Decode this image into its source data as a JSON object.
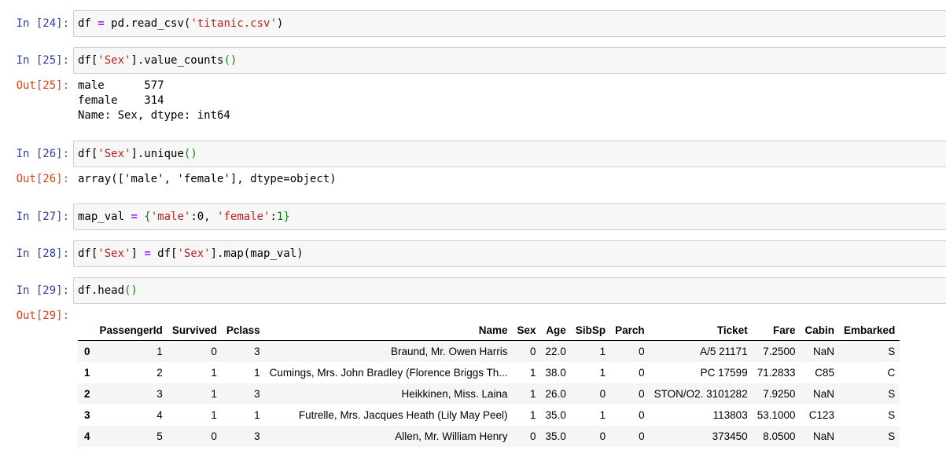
{
  "cells": [
    {
      "prompt": "In [24]:",
      "code": [
        {
          "t": "df ",
          "c": ""
        },
        {
          "t": "=",
          "c": "op"
        },
        {
          "t": " pd.read_csv(",
          "c": ""
        },
        {
          "t": "'titanic.csv'",
          "c": "str"
        },
        {
          "t": ")",
          "c": ""
        }
      ]
    },
    {
      "prompt": "In [25]:",
      "code": [
        {
          "t": "df[",
          "c": ""
        },
        {
          "t": "'Sex'",
          "c": "str"
        },
        {
          "t": "].value_counts",
          "c": ""
        },
        {
          "t": "()",
          "c": "par"
        }
      ]
    },
    {
      "prompt": "In [26]:",
      "code": [
        {
          "t": "df[",
          "c": ""
        },
        {
          "t": "'Sex'",
          "c": "str"
        },
        {
          "t": "].unique",
          "c": ""
        },
        {
          "t": "()",
          "c": "par"
        }
      ]
    },
    {
      "prompt": "In [27]:",
      "code": [
        {
          "t": "map_val ",
          "c": ""
        },
        {
          "t": "=",
          "c": "op"
        },
        {
          "t": " ",
          "c": ""
        },
        {
          "t": "{",
          "c": "par"
        },
        {
          "t": "'male'",
          "c": "str"
        },
        {
          "t": ":0, ",
          "c": ""
        },
        {
          "t": "'female'",
          "c": "str"
        },
        {
          "t": ":",
          "c": ""
        },
        {
          "t": "1",
          "c": "num"
        },
        {
          "t": "}",
          "c": "par"
        }
      ]
    },
    {
      "prompt": "In [28]:",
      "code": [
        {
          "t": "df[",
          "c": ""
        },
        {
          "t": "'Sex'",
          "c": "str"
        },
        {
          "t": "] ",
          "c": ""
        },
        {
          "t": "=",
          "c": "op"
        },
        {
          "t": " df[",
          "c": ""
        },
        {
          "t": "'Sex'",
          "c": "str"
        },
        {
          "t": "].map(map_val)",
          "c": ""
        }
      ]
    },
    {
      "prompt": "In [29]:",
      "code": [
        {
          "t": "df.head",
          "c": ""
        },
        {
          "t": "()",
          "c": "par"
        }
      ]
    }
  ],
  "outputs": {
    "out25": {
      "prompt": "Out[25]:",
      "text": "male      577\nfemale    314\nName: Sex, dtype: int64"
    },
    "out26": {
      "prompt": "Out[26]:",
      "text": "array(['male', 'female'], dtype=object)"
    },
    "out29": {
      "prompt": "Out[29]:"
    }
  },
  "dataframe": {
    "columns": [
      "",
      "PassengerId",
      "Survived",
      "Pclass",
      "Name",
      "Sex",
      "Age",
      "SibSp",
      "Parch",
      "Ticket",
      "Fare",
      "Cabin",
      "Embarked"
    ],
    "rows": [
      [
        "0",
        "1",
        "0",
        "3",
        "Braund, Mr. Owen Harris",
        "0",
        "22.0",
        "1",
        "0",
        "A/5 21171",
        "7.2500",
        "NaN",
        "S"
      ],
      [
        "1",
        "2",
        "1",
        "1",
        "Cumings, Mrs. John Bradley (Florence Briggs Th...",
        "1",
        "38.0",
        "1",
        "0",
        "PC 17599",
        "71.2833",
        "C85",
        "C"
      ],
      [
        "2",
        "3",
        "1",
        "3",
        "Heikkinen, Miss. Laina",
        "1",
        "26.0",
        "0",
        "0",
        "STON/O2. 3101282",
        "7.9250",
        "NaN",
        "S"
      ],
      [
        "3",
        "4",
        "1",
        "1",
        "Futrelle, Mrs. Jacques Heath (Lily May Peel)",
        "1",
        "35.0",
        "1",
        "0",
        "113803",
        "53.1000",
        "C123",
        "S"
      ],
      [
        "4",
        "5",
        "0",
        "3",
        "Allen, Mr. William Henry",
        "0",
        "35.0",
        "0",
        "0",
        "373450",
        "8.0500",
        "NaN",
        "S"
      ]
    ]
  }
}
